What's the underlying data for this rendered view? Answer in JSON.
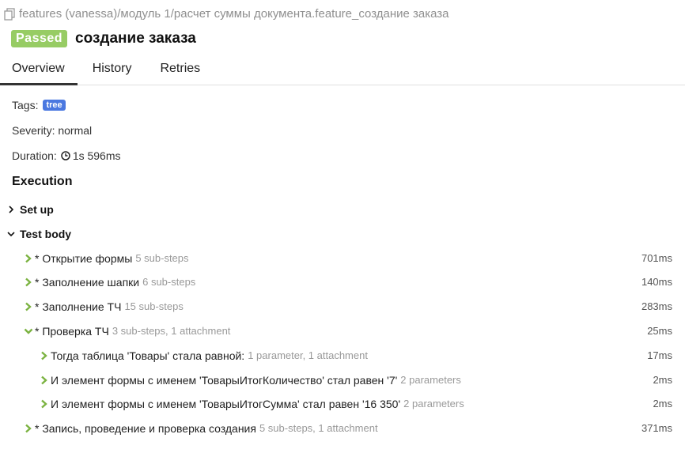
{
  "header": {
    "breadcrumb": "features (vanessa)/модуль 1/расчет суммы документа.feature_создание заказа",
    "status": "Passed",
    "title": "создание заказа"
  },
  "tabs": [
    {
      "label": "Overview",
      "active": true
    },
    {
      "label": "History",
      "active": false
    },
    {
      "label": "Retries",
      "active": false
    }
  ],
  "meta": {
    "tags_label": "Tags:",
    "tag": "tree",
    "severity": "Severity: normal",
    "duration_label": "Duration:",
    "duration": "1s 596ms"
  },
  "execution": {
    "title": "Execution",
    "setup_label": "Set up",
    "body_label": "Test body",
    "steps": [
      {
        "name": "* Открытие формы",
        "sub": "5 sub-steps",
        "dur": "701ms"
      },
      {
        "name": "* Заполнение шапки",
        "sub": "6 sub-steps",
        "dur": "140ms"
      },
      {
        "name": "* Заполнение ТЧ",
        "sub": "15 sub-steps",
        "dur": "283ms"
      },
      {
        "name": "* Проверка ТЧ",
        "sub": "3 sub-steps, 1 attachment",
        "dur": "25ms"
      },
      {
        "name": "Тогда таблица 'Товары' стала равной:",
        "sub": "1 parameter, 1 attachment",
        "dur": "17ms"
      },
      {
        "name": "И элемент формы с именем 'ТоварыИтогКоличество' стал равен '7'",
        "sub": "2 parameters",
        "dur": "2ms"
      },
      {
        "name": "И элемент формы с именем 'ТоварыИтогСумма' стал равен '16 350'",
        "sub": "2 parameters",
        "dur": "2ms"
      },
      {
        "name": "* Запись, проведение и проверка создания",
        "sub": "5 sub-steps, 1 attachment",
        "dur": "371ms"
      }
    ]
  },
  "colors": {
    "passed": "#97cc64",
    "tag": "#4a78e0",
    "arrow": "#7cb342"
  },
  "icons": [
    "copy-icon",
    "clock-icon",
    "chevron-right-icon",
    "chevron-down-icon"
  ]
}
